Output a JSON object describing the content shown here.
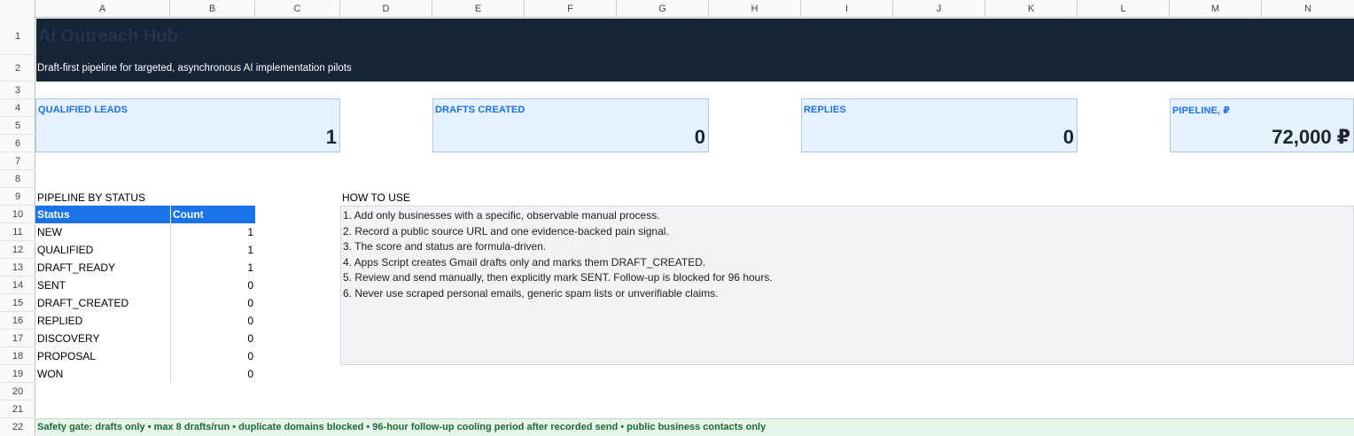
{
  "columns": [
    "A",
    "B",
    "C",
    "D",
    "E",
    "F",
    "G",
    "H",
    "I",
    "J",
    "K",
    "L",
    "M",
    "N"
  ],
  "rows": [
    "1",
    "2",
    "3",
    "4",
    "5",
    "6",
    "7",
    "8",
    "9",
    "10",
    "11",
    "12",
    "13",
    "14",
    "15",
    "16",
    "17",
    "18",
    "19",
    "20",
    "21",
    "22"
  ],
  "banner": {
    "title": "AI Outreach Hub",
    "subtitle": "Draft-first pipeline for targeted, asynchronous AI implementation pilots"
  },
  "kpis": {
    "qualified_leads": {
      "label": "QUALIFIED LEADS",
      "value": "1"
    },
    "drafts_created": {
      "label": "DRAFTS CREATED",
      "value": "0"
    },
    "replies": {
      "label": "REPLIES",
      "value": "0"
    },
    "pipeline": {
      "label": "PIPELINE, ₽",
      "value": "72,000 ₽"
    }
  },
  "pipeline_by_status": {
    "title": "PIPELINE BY STATUS",
    "headers": {
      "status": "Status",
      "count": "Count"
    },
    "rows": [
      {
        "status": "NEW",
        "count": "1"
      },
      {
        "status": "QUALIFIED",
        "count": "1"
      },
      {
        "status": "DRAFT_READY",
        "count": "1"
      },
      {
        "status": "SENT",
        "count": "0"
      },
      {
        "status": "DRAFT_CREATED",
        "count": "0"
      },
      {
        "status": "REPLIED",
        "count": "0"
      },
      {
        "status": "DISCOVERY",
        "count": "0"
      },
      {
        "status": "PROPOSAL",
        "count": "0"
      },
      {
        "status": "WON",
        "count": "0"
      }
    ]
  },
  "how_to_use": {
    "title": "HOW TO USE",
    "lines": [
      "1. Add only businesses with a specific, observable manual process.",
      "2. Record a public source URL and one evidence-backed pain signal.",
      "3. The score and status are formula-driven.",
      "4. Apps Script creates Gmail drafts only and marks them DRAFT_CREATED.",
      "5. Review and send manually, then explicitly mark SENT. Follow-up is blocked for 96 hours.",
      "6. Never use scraped personal emails, generic spam lists or unverifiable claims."
    ]
  },
  "safety_gate": "Safety gate: drafts only • max 8 drafts/run • duplicate domains blocked • 96-hour follow-up cooling period after recorded send • public business contacts only",
  "colors": {
    "banner_bg": "#172337",
    "accent": "#1a73e8",
    "kpi_bg": "#e6f1fd",
    "safety_bg": "#e6f4ea",
    "safety_text": "#1e6b35"
  }
}
